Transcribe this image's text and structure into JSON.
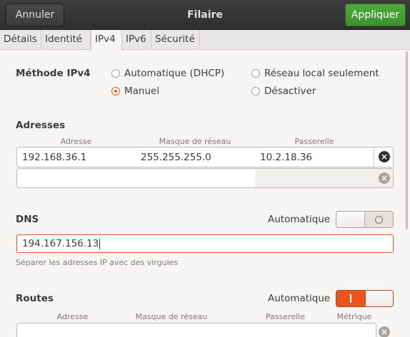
{
  "header": {
    "title": "Filaire",
    "cancel_label": "Annuler",
    "apply_label": "Appliquer"
  },
  "tabs": [
    "Détails",
    "Identité",
    "IPv4",
    "IPv6",
    "Sécurité"
  ],
  "active_tab": "IPv4",
  "method": {
    "label": "Méthode IPv4",
    "options": [
      "Automatique (DHCP)",
      "Réseau local seulement",
      "Manuel",
      "Désactiver"
    ],
    "selected": "Manuel"
  },
  "addresses": {
    "label": "Adresses",
    "columns": [
      "Adresse",
      "Masque de réseau",
      "Passerelle"
    ],
    "rows": [
      [
        "192.168.36.1",
        "255.255.255.0",
        "10.2.18.36"
      ],
      [
        "",
        "",
        ""
      ]
    ]
  },
  "dns": {
    "label": "DNS",
    "auto_label": "Automatique",
    "auto_on": false,
    "value": "194.167.156.13",
    "hint": "Séparer les adresses IP avec des virgules"
  },
  "routes": {
    "label": "Routes",
    "auto_label": "Automatique",
    "auto_on": true,
    "columns": [
      "Adresse",
      "Masque de réseau",
      "Passerelle",
      "Métrique"
    ]
  },
  "icons": {
    "delete": "close-circle-icon",
    "switch_off": "ring-icon",
    "switch_on": "bar-icon"
  },
  "colors": {
    "accent": "#e95420",
    "apply": "#3e9330",
    "header": "#333333"
  }
}
